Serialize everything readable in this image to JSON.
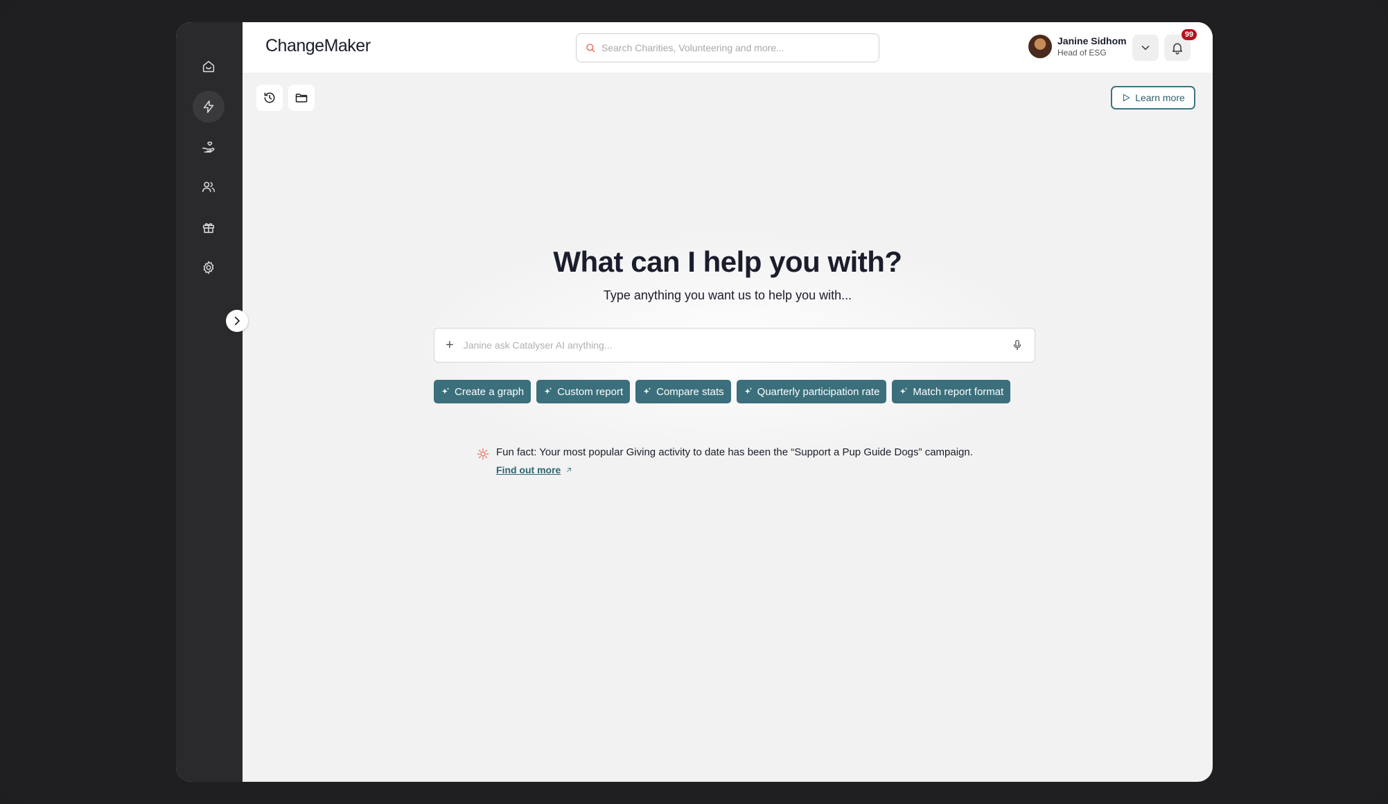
{
  "app": {
    "brand": "ChangeMaker"
  },
  "colors": {
    "accent": "#3b6f7b",
    "sidebar": "#2a2a2d",
    "badge": "#b3141c",
    "fact_icon": "#e25a3f"
  },
  "sidebar": {
    "items": [
      {
        "icon": "home-icon",
        "active": false
      },
      {
        "icon": "lightning-icon",
        "active": true
      },
      {
        "icon": "hand-heart-icon",
        "active": false
      },
      {
        "icon": "users-icon",
        "active": false
      },
      {
        "icon": "gift-icon",
        "active": false
      },
      {
        "icon": "gear-icon",
        "active": false
      }
    ],
    "collapse_icon": "chevron-right-icon"
  },
  "header": {
    "search_placeholder": "Search Charities, Volunteering and more...",
    "user": {
      "name": "Janine Sidhom",
      "role": "Head of ESG"
    },
    "notifications_count": "99"
  },
  "toolbar": {
    "history_icon": "history-icon",
    "folder_icon": "folder-icon",
    "learn_more_label": "Learn more"
  },
  "hero": {
    "title": "What can I help you with?",
    "subtitle": "Type anything you want us to help you with...",
    "ask_placeholder": "Janine ask Catalyser AI anything...",
    "suggestions": [
      "Create a graph",
      "Custom report",
      "Compare stats",
      "Quarterly participation rate",
      "Match report format"
    ]
  },
  "fun_fact": {
    "text": "Fun fact: Your most popular Giving activity to date has been the “Support a Pup Guide Dogs” campaign.",
    "link_label": "Find out more"
  }
}
